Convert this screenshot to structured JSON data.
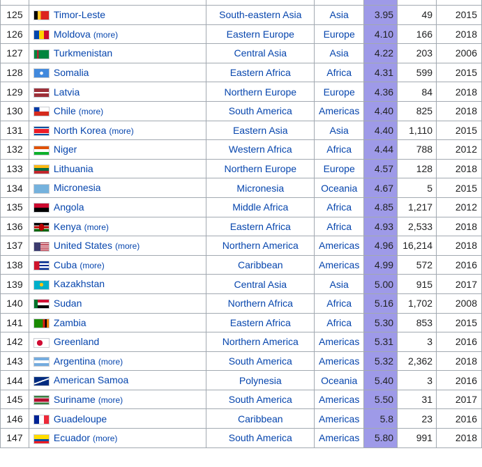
{
  "rows": [
    {
      "rank": "125",
      "country": "Timor-Leste",
      "more": "",
      "subregion": "South-eastern Asia",
      "region": "Asia",
      "rate": "3.95",
      "count": "49",
      "year": "2015",
      "flag": "linear-gradient(90deg,#000 0 25%,#ffc726 25% 45%,#dc241f 45%)"
    },
    {
      "rank": "126",
      "country": "Moldova",
      "more": "(more)",
      "subregion": "Eastern Europe",
      "region": "Europe",
      "rate": "4.10",
      "count": "166",
      "year": "2018",
      "flag": "linear-gradient(90deg,#0046ae 0 33%,#ffd200 33% 66%,#cc092f 66%)"
    },
    {
      "rank": "127",
      "country": "Turkmenistan",
      "more": "",
      "subregion": "Central Asia",
      "region": "Asia",
      "rate": "4.22",
      "count": "203",
      "year": "2006",
      "flag": "linear-gradient(90deg,#00843d 0 20%,#b22234 20% 32%,#00843d 32%)"
    },
    {
      "rank": "128",
      "country": "Somalia",
      "more": "",
      "subregion": "Eastern Africa",
      "region": "Africa",
      "rate": "4.31",
      "count": "599",
      "year": "2015",
      "flag": "radial-gradient(circle at 50% 50%,#fff 0 18%,#4189dd 20%)"
    },
    {
      "rank": "129",
      "country": "Latvia",
      "more": "",
      "subregion": "Northern Europe",
      "region": "Europe",
      "rate": "4.36",
      "count": "84",
      "year": "2018",
      "flag": "linear-gradient(180deg,#9e3039 0 40%,#fff 40% 60%,#9e3039 60%)"
    },
    {
      "rank": "130",
      "country": "Chile",
      "more": "(more)",
      "subregion": "South America",
      "region": "Americas",
      "rate": "4.40",
      "count": "825",
      "year": "2018",
      "flag": "linear-gradient(180deg,transparent 0 50%,#d52b1e 50%),linear-gradient(90deg,#0039a6 0 35%,#fff 35%)"
    },
    {
      "rank": "131",
      "country": "North Korea",
      "more": "(more)",
      "subregion": "Eastern Asia",
      "region": "Asia",
      "rate": "4.40",
      "count": "1,110",
      "year": "2015",
      "flag": "linear-gradient(180deg,#024fa2 0 18%,#fff 18% 24%,#ed1c27 24% 76%,#fff 76% 82%,#024fa2 82%)"
    },
    {
      "rank": "132",
      "country": "Niger",
      "more": "",
      "subregion": "Western Africa",
      "region": "Africa",
      "rate": "4.44",
      "count": "788",
      "year": "2012",
      "flag": "linear-gradient(180deg,#e05206 0 33%,#fff 33% 66%,#0db02b 66%)"
    },
    {
      "rank": "133",
      "country": "Lithuania",
      "more": "",
      "subregion": "Northern Europe",
      "region": "Europe",
      "rate": "4.57",
      "count": "128",
      "year": "2018",
      "flag": "linear-gradient(180deg,#fdb913 0 33%,#006a44 33% 66%,#c1272d 66%)"
    },
    {
      "rank": "134",
      "country": "Micronesia",
      "more": "",
      "subregion": "Micronesia",
      "region": "Oceania",
      "rate": "4.67",
      "count": "5",
      "year": "2015",
      "flag": "linear-gradient(90deg,#75b2dd,#75b2dd)"
    },
    {
      "rank": "135",
      "country": "Angola",
      "more": "",
      "subregion": "Middle Africa",
      "region": "Africa",
      "rate": "4.85",
      "count": "1,217",
      "year": "2012",
      "flag": "linear-gradient(180deg,#cc092f 0 50%,#000 50%)"
    },
    {
      "rank": "136",
      "country": "Kenya",
      "more": "(more)",
      "subregion": "Eastern Africa",
      "region": "Africa",
      "rate": "4.93",
      "count": "2,533",
      "year": "2018",
      "flag": "radial-gradient(ellipse 20% 45% at 50% 50%,#bb0000 0 90%,transparent 95%),linear-gradient(180deg,#000 0 30%,#fff 30% 36%,#bb0000 36% 64%,#fff 64% 70%,#006600 70%)"
    },
    {
      "rank": "137",
      "country": "United States",
      "more": "(more)",
      "subregion": "Northern America",
      "region": "Americas",
      "rate": "4.96",
      "count": "16,214",
      "year": "2018",
      "flag": "linear-gradient(90deg,#3c3b6e 0 42%,transparent 42%),repeating-linear-gradient(180deg,#b22234 0 7.7%,#fff 7.7% 15.4%)"
    },
    {
      "rank": "138",
      "country": "Cuba",
      "more": "(more)",
      "subregion": "Caribbean",
      "region": "Americas",
      "rate": "4.99",
      "count": "572",
      "year": "2016",
      "flag": "linear-gradient(90deg,#cf142b 0 35%,transparent 35%),repeating-linear-gradient(180deg,#002a8f 0 20%,#fff 20% 40%)"
    },
    {
      "rank": "139",
      "country": "Kazakhstan",
      "more": "",
      "subregion": "Central Asia",
      "region": "Asia",
      "rate": "5.00",
      "count": "915",
      "year": "2017",
      "flag": "radial-gradient(circle at 50% 45%,#fec50c 0 20%,#00afca 22%)"
    },
    {
      "rank": "140",
      "country": "Sudan",
      "more": "",
      "subregion": "Northern Africa",
      "region": "Africa",
      "rate": "5.16",
      "count": "1,702",
      "year": "2008",
      "flag": "linear-gradient(90deg,#007229 0 25%,transparent 25%),linear-gradient(180deg,#d21034 0 33%,#fff 33% 66%,#000 66%)"
    },
    {
      "rank": "141",
      "country": "Zambia",
      "more": "",
      "subregion": "Eastern Africa",
      "region": "Africa",
      "rate": "5.30",
      "count": "853",
      "year": "2015",
      "flag": "linear-gradient(90deg,#198a00 0 60%,#de2010 60% 73%,#000 73% 86%,#ef7d00 86%)"
    },
    {
      "rank": "142",
      "country": "Greenland",
      "more": "",
      "subregion": "Northern America",
      "region": "Americas",
      "rate": "5.31",
      "count": "3",
      "year": "2016",
      "flag": "radial-gradient(circle at 38% 50%,#d00c33 0 28%,#fff 29%),linear-gradient(180deg,#fff 0 50%,#d00c33 50%)"
    },
    {
      "rank": "143",
      "country": "Argentina",
      "more": "(more)",
      "subregion": "South America",
      "region": "Americas",
      "rate": "5.32",
      "count": "2,362",
      "year": "2018",
      "flag": "linear-gradient(180deg,#74acdf 0 33%,#fff 33% 66%,#74acdf 66%)"
    },
    {
      "rank": "144",
      "country": "American Samoa",
      "more": "",
      "subregion": "Polynesia",
      "region": "Oceania",
      "rate": "5.40",
      "count": "3",
      "year": "2016",
      "flag": "linear-gradient(160deg,#002b7f 0 45%,#fff 45% 55%,#002b7f 55%)"
    },
    {
      "rank": "145",
      "country": "Suriname",
      "more": "(more)",
      "subregion": "South America",
      "region": "Americas",
      "rate": "5.50",
      "count": "31",
      "year": "2017",
      "flag": "linear-gradient(180deg,#377e3f 0 20%,#fff 20% 28%,#b40a2d 28% 72%,#fff 72% 80%,#377e3f 80%)"
    },
    {
      "rank": "146",
      "country": "Guadeloupe",
      "more": "",
      "subregion": "Caribbean",
      "region": "Americas",
      "rate": "5.8",
      "count": "23",
      "year": "2016",
      "flag": "linear-gradient(90deg,#002395 0 33%,#fff 33% 66%,#ed2939 66%)"
    },
    {
      "rank": "147",
      "country": "Ecuador",
      "more": "(more)",
      "subregion": "South America",
      "region": "Americas",
      "rate": "5.80",
      "count": "991",
      "year": "2018",
      "flag": "linear-gradient(180deg,#ffdd00 0 50%,#034ea2 50% 75%,#ed1c24 75%)"
    }
  ]
}
